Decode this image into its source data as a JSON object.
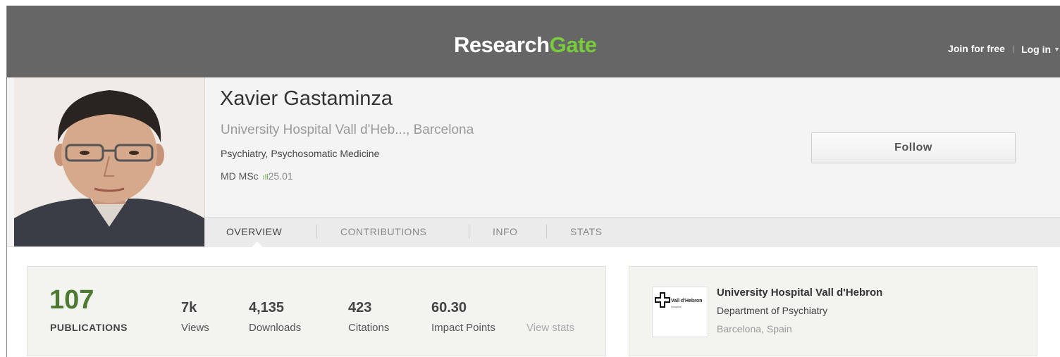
{
  "header": {
    "logo_research": "Research",
    "logo_gate": "Gate",
    "join_label": "Join for free",
    "login_label": "Log in"
  },
  "profile": {
    "name": "Xavier Gastaminza",
    "affiliation": "University Hospital Vall d'Heb..., Barcelona",
    "department": "Psychiatry, Psychosomatic Medicine",
    "degrees": "MD MSc",
    "rg_score": "25.01",
    "follow_label": "Follow"
  },
  "tabs": [
    {
      "label": "OVERVIEW",
      "active": true
    },
    {
      "label": "CONTRIBUTIONS",
      "active": false
    },
    {
      "label": "INFO",
      "active": false
    },
    {
      "label": "STATS",
      "active": false
    }
  ],
  "stats": {
    "publications_count": "107",
    "publications_label": "PUBLICATIONS",
    "items": [
      {
        "value": "7k",
        "label": "Views"
      },
      {
        "value": "4,135",
        "label": "Downloads"
      },
      {
        "value": "423",
        "label": "Citations"
      },
      {
        "value": "60.30",
        "label": "Impact Points"
      }
    ],
    "view_stats_label": "View stats"
  },
  "institution": {
    "logo_name": "Vall d'Hebron",
    "logo_sub": "Hospital",
    "name": "University Hospital Vall d'Hebron",
    "department": "Department of Psychiatry",
    "location": "Barcelona, Spain"
  },
  "colors": {
    "header_bg": "#666666",
    "brand_green": "#78cc3c",
    "publications_green": "#4c7a33"
  }
}
